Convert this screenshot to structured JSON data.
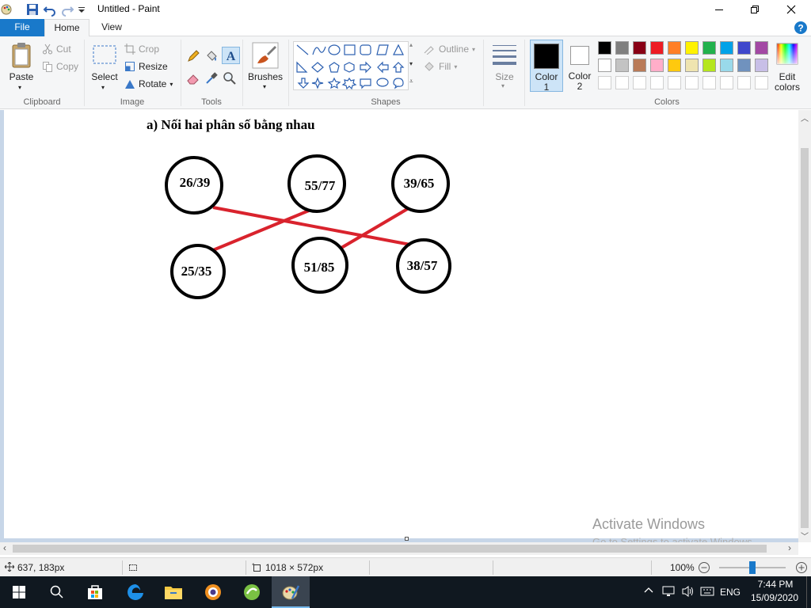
{
  "window": {
    "title": "Untitled - Paint",
    "minimize_icon": "minimize-icon",
    "maximize_icon": "restore-icon",
    "close_icon": "close-icon"
  },
  "tabs": [
    {
      "label": "File"
    },
    {
      "label": "Home"
    },
    {
      "label": "View"
    }
  ],
  "ribbon": {
    "clipboard": {
      "label": "Clipboard",
      "paste": "Paste",
      "cut": "Cut",
      "copy": "Copy"
    },
    "image": {
      "label": "Image",
      "select": "Select",
      "crop": "Crop",
      "resize": "Resize",
      "rotate": "Rotate"
    },
    "tools": {
      "label": "Tools"
    },
    "brushes": {
      "label": "Brushes"
    },
    "shapes": {
      "label": "Shapes",
      "outline": "Outline",
      "fill": "Fill"
    },
    "size": {
      "label": "Size"
    },
    "color1": {
      "label": "Color",
      "num": "1",
      "value": "#000000"
    },
    "color2": {
      "label": "Color",
      "num": "2",
      "value": "#ffffff"
    },
    "colors": {
      "label": "Colors",
      "edit_label": "Edit",
      "edit_label2": "colors",
      "palette_row1": [
        "#000000",
        "#7f7f7f",
        "#880015",
        "#ed1c24",
        "#ff7f27",
        "#fff200",
        "#22b14c",
        "#00a2e8",
        "#3f48cc",
        "#a349a4"
      ],
      "palette_row2": [
        "#ffffff",
        "#c3c3c3",
        "#b97a57",
        "#ffaec9",
        "#ffc90e",
        "#efe4b0",
        "#b5e61d",
        "#99d9ea",
        "#7092be",
        "#c8bfe7"
      ]
    }
  },
  "canvas": {
    "heading": "a) Nối hai phân số bằng nhau",
    "fractions": {
      "f1": "26/39",
      "f2": "55/77",
      "f3": "39/65",
      "f4": "25/35",
      "f5": "51/85",
      "f6": "38/57"
    },
    "line_color": "#d9232d",
    "watermark_title": "Activate Windows",
    "watermark_sub": "Go to Settings to activate Windows."
  },
  "status": {
    "cursor_pos": "637, 183px",
    "image_size": "1018 × 572px",
    "zoom": "100%"
  },
  "taskbar": {
    "language": "ENG",
    "time": "7:44 PM",
    "date": "15/09/2020"
  }
}
